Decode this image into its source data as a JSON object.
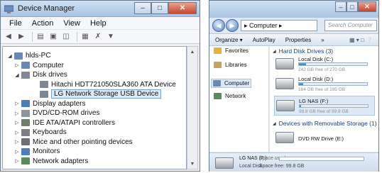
{
  "device_manager": {
    "title": "Device Manager",
    "menu": [
      "File",
      "Action",
      "View",
      "Help"
    ],
    "toolbar_icons": [
      "back-icon",
      "forward-icon",
      "properties-icon",
      "help-icon",
      "update-driver-icon",
      "scan-icon",
      "uninstall-icon",
      "disable-icon"
    ],
    "tree": [
      {
        "label": "hlds-PC",
        "level": 0,
        "expanded": true,
        "icon": "computer-icon",
        "color": "#6b87b3"
      },
      {
        "label": "Computer",
        "level": 1,
        "expanded": false,
        "icon": "computer-icon",
        "color": "#6b87b3"
      },
      {
        "label": "Disk drives",
        "level": 1,
        "expanded": true,
        "icon": "disk-icon",
        "color": "#7f8792"
      },
      {
        "label": "Hitachi HDT721050SLA360 ATA Device",
        "level": 2,
        "icon": "disk-icon",
        "color": "#7f8792"
      },
      {
        "label": "LG Network Storage USB Device",
        "level": 2,
        "icon": "disk-icon",
        "color": "#7f8792",
        "selected": true
      },
      {
        "label": "Display adapters",
        "level": 1,
        "expanded": false,
        "icon": "display-icon",
        "color": "#4a7fb8"
      },
      {
        "label": "DVD/CD-ROM drives",
        "level": 1,
        "expanded": false,
        "icon": "dvd-icon",
        "color": "#8d949c"
      },
      {
        "label": "IDE ATA/ATAPI controllers",
        "level": 1,
        "expanded": false,
        "icon": "controller-icon",
        "color": "#6f7f6a"
      },
      {
        "label": "Keyboards",
        "level": 1,
        "expanded": false,
        "icon": "keyboard-icon",
        "color": "#7d7f85"
      },
      {
        "label": "Mice and other pointing devices",
        "level": 1,
        "expanded": false,
        "icon": "mouse-icon",
        "color": "#6e7076"
      },
      {
        "label": "Monitors",
        "level": 1,
        "expanded": false,
        "icon": "monitor-icon",
        "color": "#4a7fb8"
      },
      {
        "label": "Network adapters",
        "level": 1,
        "expanded": false,
        "icon": "network-icon",
        "color": "#5d8a5a"
      }
    ]
  },
  "explorer": {
    "address": "▸ Computer ▸",
    "search_placeholder": "Search Computer",
    "commands": [
      "Organize ▾",
      "AutoPlay",
      "Properties",
      "»"
    ],
    "nav_pane": [
      {
        "label": "Favorites",
        "icon": "star-icon",
        "color": "#e5b23a"
      },
      {
        "label": "Libraries",
        "icon": "library-icon",
        "color": "#c9a25a"
      },
      {
        "label": "Computer",
        "icon": "computer-icon",
        "color": "#6b87b3",
        "selected": true
      },
      {
        "label": "Network",
        "icon": "network-icon",
        "color": "#5d8a5a"
      }
    ],
    "sections": [
      {
        "title": "Hard Disk Drives (3)"
      },
      {
        "title": "Devices with Removable Storage (1)"
      }
    ],
    "drives": [
      {
        "name": "Local Disk (C:)",
        "free": "242 GB free of 270 GB",
        "used_fraction": 0.1
      },
      {
        "name": "Local Disk (D:)",
        "free": "184 GB free of 195 GB",
        "used_fraction": 0.06
      },
      {
        "name": "LG NAS (F:)",
        "free": "99.8 GB free of 99.9 GB",
        "used_fraction": 0.01,
        "selected": true
      },
      {
        "name": "DVD RW Drive (E:)",
        "free": "",
        "used_fraction": null
      }
    ],
    "status": {
      "name": "LG NAS (F:)",
      "space_used_label": "Space used:",
      "type": "Local Disk",
      "space_free": "Space free: 99.8 GB"
    }
  }
}
